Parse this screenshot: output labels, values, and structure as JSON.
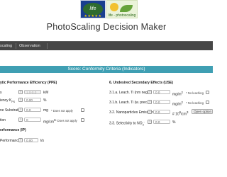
{
  "header": {
    "logo_eu_text": "life",
    "logo_ph_text": "life - photoscaling",
    "title": "PhotoScaling Decision Maker"
  },
  "nav": {
    "items": [
      "scaling",
      "Observation"
    ]
  },
  "banner": {
    "text": "Score: Conformity Criteria (Indicators)"
  },
  "left": {
    "section1_title": "ytic Performance Efficiency (PPE)",
    "rows": [
      {
        "label": "s",
        "value": "1.0-0.0",
        "unit": "kW"
      },
      {
        "label": "iency K",
        "label_sub": "PS",
        "value": "0.00",
        "unit": "%"
      },
      {
        "label": "ne Substrate",
        "value": "0.0",
        "unit": "mg",
        "note": "* Does not apply"
      },
      {
        "label": "tion",
        "value": "0",
        "unit": "mg/cm",
        "unit_sup": "3",
        "note": "* Does not apply"
      }
    ],
    "section2_title": "erformance (IP)",
    "ip_row": {
      "label": "Performance",
      "value": "0.00",
      "unit": "l/s"
    }
  },
  "right": {
    "section_title": "6. Undesired Secondary Effects (USE)",
    "rows": [
      {
        "label": "3.1.a. Leach. Ti (nm neg.)",
        "value": "0.0",
        "unit": "mg/m",
        "unit_sup": "2",
        "note": "* No leaching"
      },
      {
        "label": "3.1.b. Leach. Ti (w. prec.)",
        "value": "0.0",
        "unit": "mg/m",
        "unit_sup": "2",
        "note": "* No leaching"
      },
      {
        "label": "3.2. Nanoparticles Emission",
        "value": "0.0",
        "unit": "# 10",
        "unit_sup": "6",
        "unit_tail": "/cm",
        "unit_sup2": "3",
        "button": "Open option"
      },
      {
        "label": "3.3. Selectivity to NO",
        "label_sub": "3",
        "label_sup": "-",
        "value": "0.0",
        "unit": "%"
      }
    ]
  },
  "colors": {
    "nav_bg": "#464646",
    "banner_bg": "#3f9fb3"
  }
}
